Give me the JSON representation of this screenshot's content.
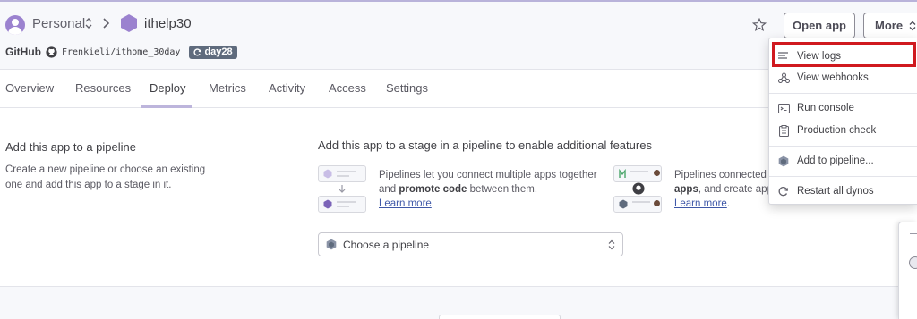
{
  "header": {
    "space_name": "Personal",
    "app_name": "ithelp30",
    "github_label": "GitHub",
    "github_repo": "Frenkieli/ithome_30day",
    "branch": "day28",
    "open_app_label": "Open app",
    "more_label": "More"
  },
  "tabs": [
    {
      "label": "Overview"
    },
    {
      "label": "Resources"
    },
    {
      "label": "Deploy"
    },
    {
      "label": "Metrics"
    },
    {
      "label": "Activity"
    },
    {
      "label": "Access"
    },
    {
      "label": "Settings"
    }
  ],
  "active_tab": "Deploy",
  "pipeline": {
    "title": "Add this app to a pipeline",
    "description": "Create a new pipeline or choose an existing one and add this app to a stage in it.",
    "stage_title": "Add this app to a stage in a pipeline to enable additional features",
    "feature1_pre": "Pipelines let you connect multiple apps together and ",
    "feature1_bold": "promote code",
    "feature1_post": " between them.",
    "feature2_pre": "Pipelines connected",
    "feature2_bold": "apps",
    "feature2_post": ", and create app",
    "learn_more": "Learn more",
    "learn_more_suffix": ".",
    "select_placeholder": "Choose a pipeline"
  },
  "more_menu": {
    "items": [
      {
        "label": "View logs",
        "icon": "logs-icon"
      },
      {
        "label": "View webhooks",
        "icon": "webhooks-icon"
      },
      {
        "label": "Run console",
        "icon": "console-icon"
      },
      {
        "label": "Production check",
        "icon": "clipboard-check-icon"
      },
      {
        "label": "Add to pipeline...",
        "icon": "pipeline-icon"
      },
      {
        "label": "Restart all dynos",
        "icon": "restart-icon"
      }
    ],
    "highlighted": "View logs"
  },
  "colors": {
    "brand_purple": "#9b82cf",
    "header_bg": "#f7f8fb",
    "highlight_red": "#d0191f",
    "branch_badge": "#5f6b7d",
    "link_blue": "#3f58a8"
  }
}
